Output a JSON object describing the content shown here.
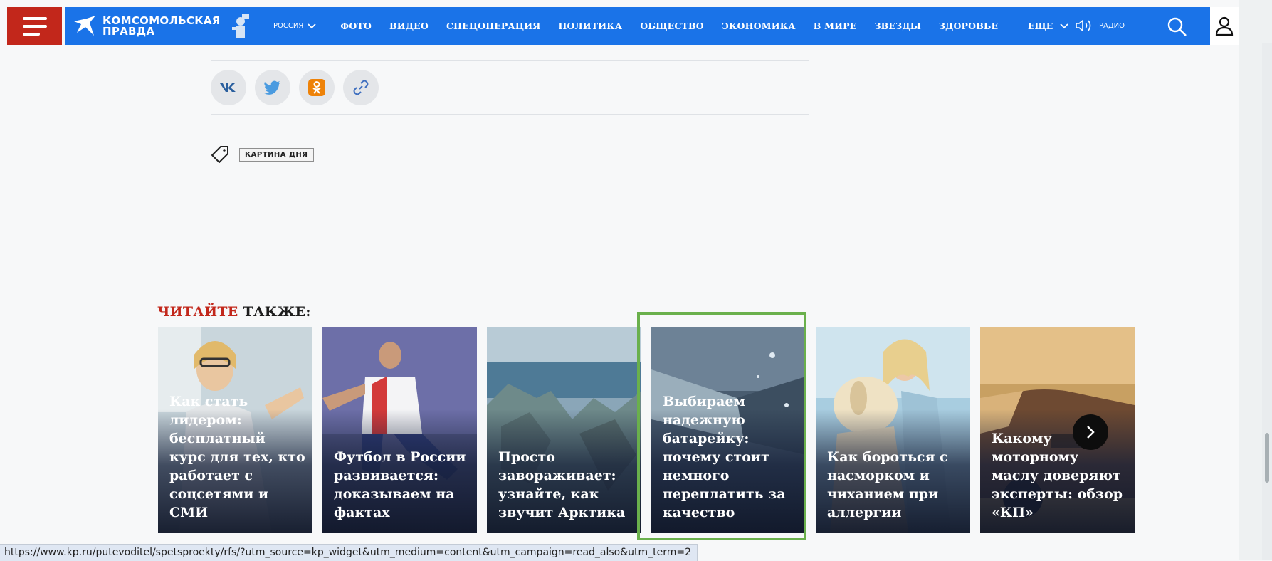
{
  "header": {
    "logo_line1": "КОМСОМОЛЬСКАЯ",
    "logo_line2": "ПРАВДА",
    "region": "РОССИЯ",
    "nav": [
      "ФОТО",
      "ВИДЕО",
      "СПЕЦОПЕРАЦИЯ",
      "ПОЛИТИКА",
      "ОБЩЕСТВО",
      "ЭКОНОМИКА",
      "В МИРЕ",
      "ЗВЕЗДЫ",
      "ЗДОРОВЬЕ"
    ],
    "more": "ЕЩЕ",
    "radio": "РАДИО",
    "colors": {
      "brand_red": "#c2271b",
      "brand_blue": "#1a73e8"
    }
  },
  "share": {
    "icons": [
      "vk-icon",
      "twitter-icon",
      "odnoklassniki-icon",
      "link-icon"
    ]
  },
  "tags": {
    "items": [
      "КАРТИНА ДНЯ"
    ]
  },
  "read_also": {
    "title_red": "ЧИТАЙТЕ",
    "title_dark": "ТАКЖЕ:",
    "cards": [
      {
        "title": "Как стать лидером: бесплатный курс для тех, кто работает с соцсетями и СМИ"
      },
      {
        "title": "Футбол в России развивается: доказываем на фактах"
      },
      {
        "title": "Просто завораживает: узнайте, как звучит Арктика"
      },
      {
        "title": "Выбираем надежную батарейку: почему стоит немного переплатить за качество"
      },
      {
        "title": "Как бороться с насморком и чиханием при аллергии"
      },
      {
        "title": "Какому моторному маслу доверяют эксперты: обзор «КП»"
      }
    ]
  },
  "status_url": "https://www.kp.ru/putevoditel/spetsproekty/rfs/?utm_source=kp_widget&utm_medium=content&utm_campaign=read_also&utm_term=2"
}
